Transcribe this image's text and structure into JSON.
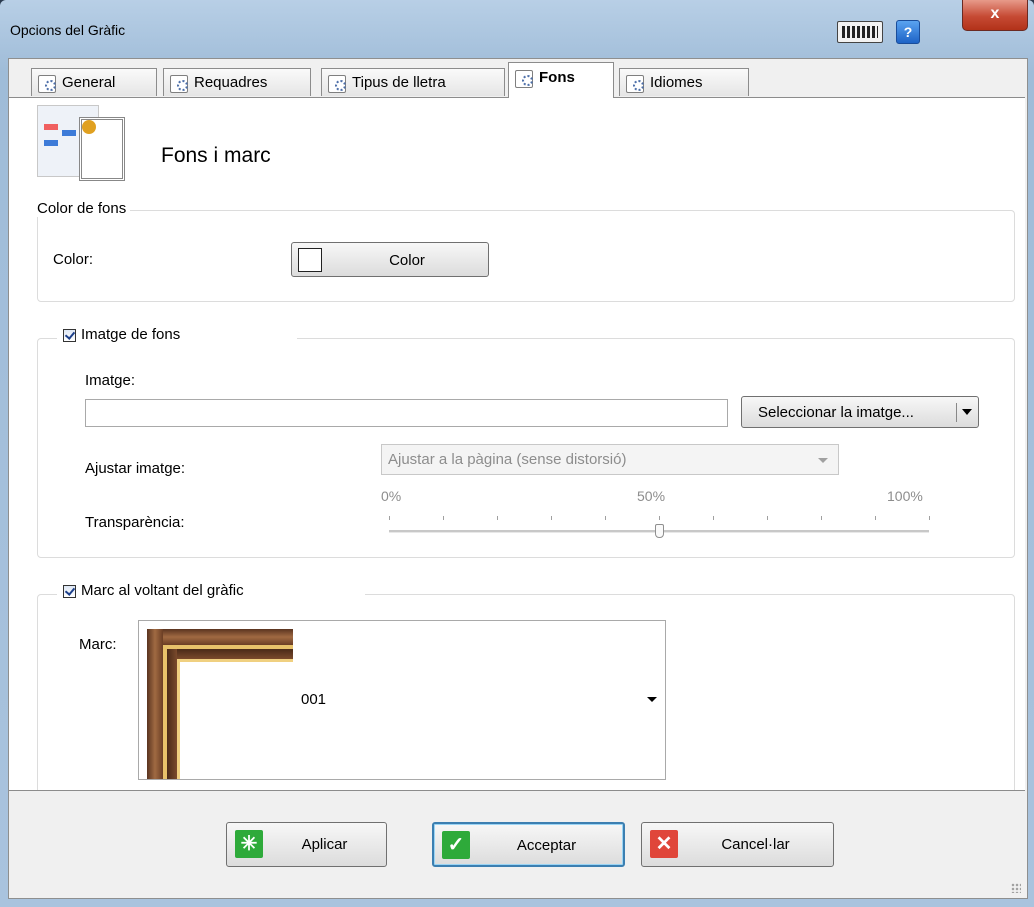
{
  "window": {
    "title": "Opcions del Gràfic",
    "close_label": "x",
    "help_label": "?"
  },
  "tabs": [
    {
      "label": "General",
      "active": false
    },
    {
      "label": "Requadres",
      "active": false
    },
    {
      "label": "Tipus de lletra",
      "active": false
    },
    {
      "label": "Fons",
      "active": true
    },
    {
      "label": "Idiomes",
      "active": false
    }
  ],
  "header": {
    "title": "Fons i marc"
  },
  "background_color": {
    "legend": "Color de fons",
    "color_label": "Color:",
    "button_label": "Color",
    "swatch": "#ffffff"
  },
  "background_image": {
    "legend": "Imatge de fons",
    "checked": true,
    "image_label": "Imatge:",
    "image_value": "",
    "select_button": "Seleccionar la imatge...",
    "fit_label": "Ajustar imatge:",
    "fit_value": "Ajustar a la pàgina (sense distorsió)",
    "transparency_label": "Transparència:",
    "tick_labels": [
      "0%",
      "50%",
      "100%"
    ],
    "transparency_value_percent": 50
  },
  "frame": {
    "legend": "Marc al voltant del gràfic",
    "checked": true,
    "frame_label": "Marc:",
    "frame_value": "001"
  },
  "footer": {
    "apply_label": "Aplicar",
    "accept_label": "Acceptar",
    "cancel_label": "Cancel·lar"
  },
  "colors": {
    "apply_icon": "#2eaa3a",
    "accept_icon": "#2eaa3a",
    "cancel_icon": "#e0463a"
  }
}
